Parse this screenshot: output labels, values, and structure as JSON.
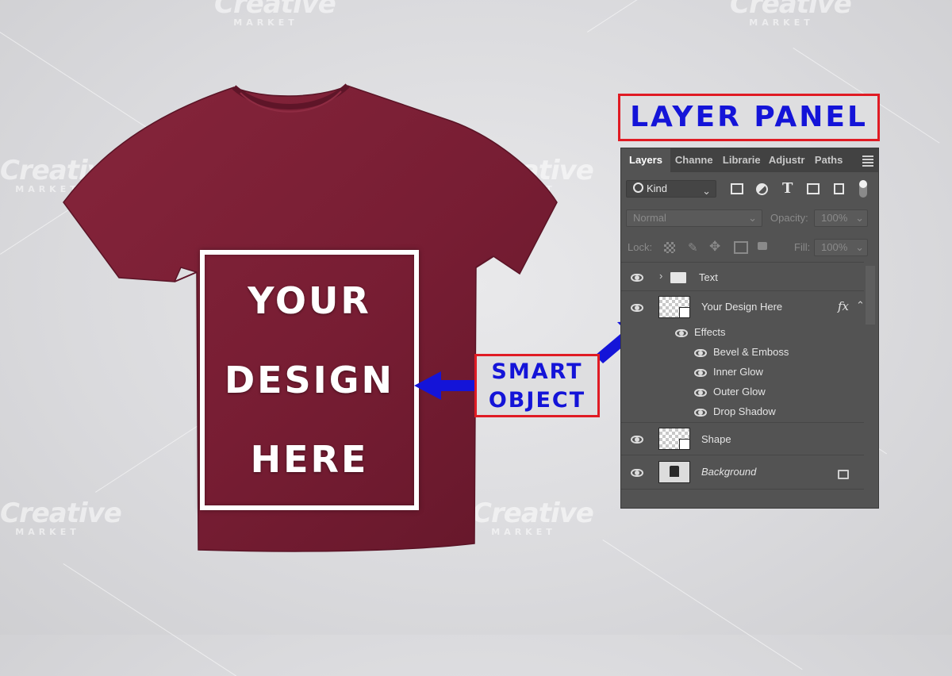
{
  "design": {
    "line1": "YOUR",
    "line2": "DESIGN",
    "line3": "HERE"
  },
  "callout": {
    "line1": "SMART",
    "line2": "OBJECT"
  },
  "panel_title": "LAYER PANEL",
  "watermark": {
    "word": "Creative",
    "sub": "MARKET"
  },
  "colors": {
    "shirt": "#7a1e32",
    "arrow": "#1414d8",
    "callout_border": "#e01b24",
    "panel_bg": "#535353"
  },
  "photoshop": {
    "tabs": [
      "Layers",
      "Channe",
      "Librarie",
      "Adjustr",
      "Paths"
    ],
    "filter_kind": "Kind",
    "filter_icons": [
      "image-filter-icon",
      "adjustment-filter-icon",
      "type-filter-icon",
      "shape-filter-icon",
      "smart-object-filter-icon",
      "filter-toggle-icon"
    ],
    "blend_mode": "Normal",
    "opacity_label": "Opacity:",
    "opacity_value": "100%",
    "lock_label": "Lock:",
    "fill_label": "Fill:",
    "fill_value": "100%",
    "layers": {
      "text": "Text",
      "design": "Your Design Here",
      "fx": "fx",
      "effects": "Effects",
      "effect_items": [
        "Bevel & Emboss",
        "Inner Glow",
        "Outer Glow",
        "Drop Shadow"
      ],
      "shape": "Shape",
      "background": "Background"
    }
  }
}
